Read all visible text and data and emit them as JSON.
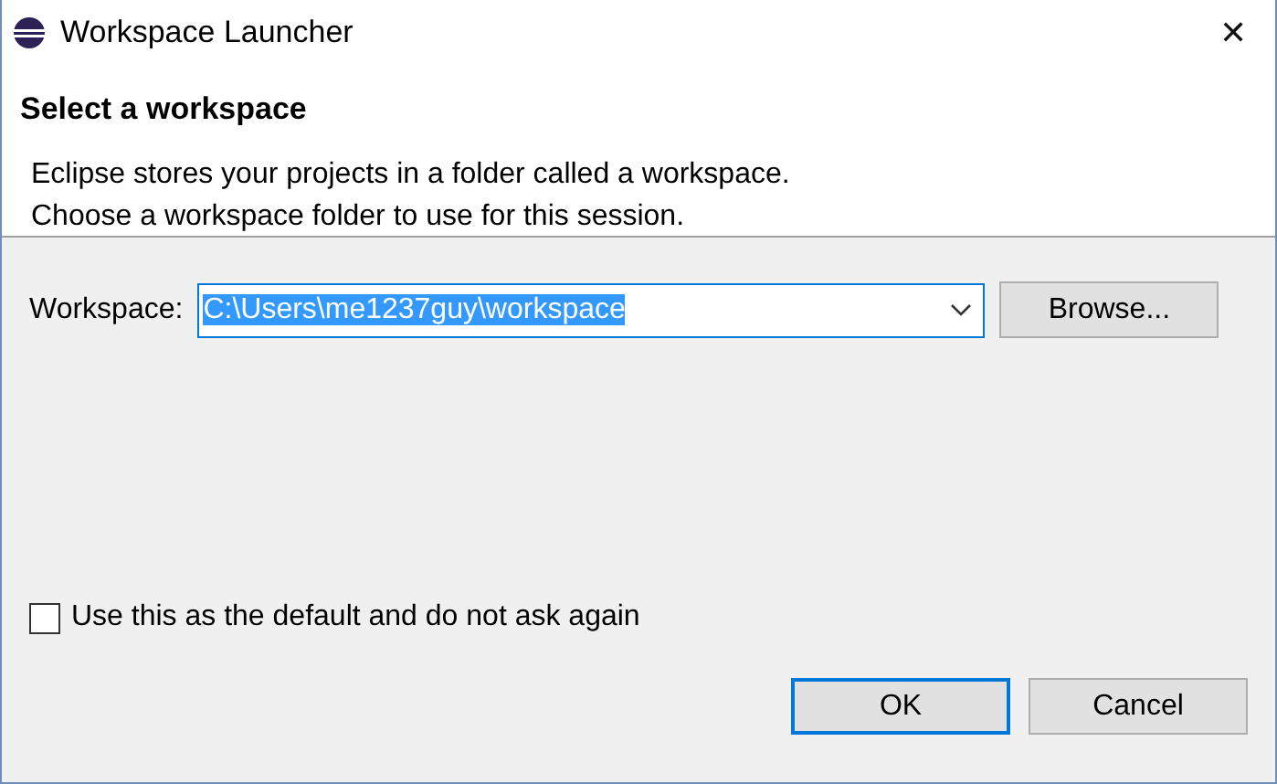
{
  "window": {
    "title": "Workspace Launcher",
    "close": "✕"
  },
  "header": {
    "title": "Select a workspace",
    "description": [
      "Eclipse stores your projects in a folder called a workspace.",
      "Choose a workspace folder to use for this session."
    ]
  },
  "workspace": {
    "label": "Workspace:",
    "value": "C:\\Users\\me1237guy\\workspace",
    "selected_text": true,
    "browse": "Browse..."
  },
  "default_option": {
    "label": "Use this as the default and do not ask again",
    "checked": false
  },
  "buttons": [
    {
      "label": "OK",
      "default": true
    },
    {
      "label": "Cancel",
      "default": false
    }
  ]
}
